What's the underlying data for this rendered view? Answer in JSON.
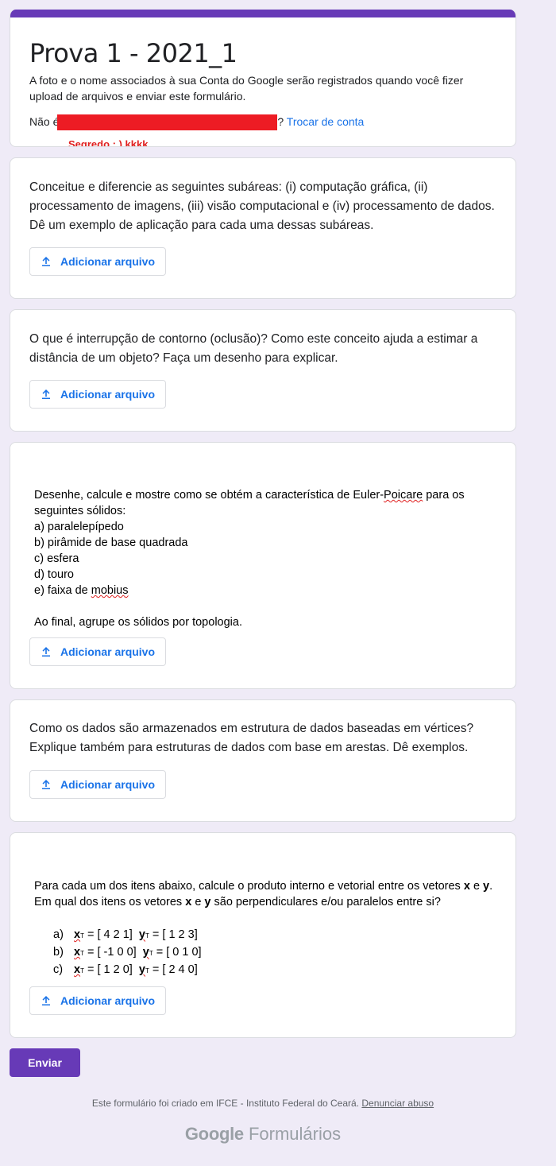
{
  "header": {
    "title": "Prova 1 - 2021_1",
    "notice": "A foto e o nome associados à sua Conta do Google serão registrados quando você fizer upload de arquivos e enviar este formulário.",
    "not_you_prefix": "Não é",
    "not_you_suffix": "?",
    "switch_account": "Trocar de conta",
    "annotation": "Segredo ; ) kkkk",
    "accent_color": "#673ab7",
    "redaction_color": "#ed1c24"
  },
  "questions": [
    {
      "text": "Conceitue e diferencie as seguintes subáreas: (i) computação gráfica, (ii) processamento de imagens, (iii) visão computacional e (iv) processamento de dados. Dê um exemplo de aplicação para cada uma dessas subáreas.",
      "upload_label": "Adicionar arquivo"
    },
    {
      "text": "O que é interrupção de contorno (oclusão)? Como este conceito ajuda a estimar a distância de um objeto? Faça um desenho para explicar.",
      "upload_label": "Adicionar arquivo"
    },
    {
      "image_text": {
        "intro_a": "Desenhe, calcule e mostre como se obtém a característica de Euler-",
        "intro_b": "Poicare",
        "intro_c": " para os seguintes sólidos:",
        "items": [
          "a) paralelepípedo",
          "b) pirâmide de base quadrada",
          "c) esfera",
          "d) touro"
        ],
        "item_e_prefix": "e) faixa de ",
        "item_e_word": "mobius",
        "closing": "Ao final, agrupe os sólidos por topologia."
      },
      "upload_label": "Adicionar arquivo"
    },
    {
      "text": "Como os dados são armazenados em estrutura de dados baseadas em vértices? Explique também para estruturas de dados com base em arestas. Dê exemplos.",
      "upload_label": "Adicionar arquivo"
    },
    {
      "image_text": {
        "intro_1": "Para cada um dos itens abaixo, calcule o produto interno e vetorial entre os vetores ",
        "x": "x",
        "intro_2": " e ",
        "y": "y",
        "intro_3": ". Em qual dos itens os vetores ",
        "intro_4": " e ",
        "intro_5": " são perpendiculares e/ou paralelos entre si?",
        "rows": [
          {
            "label": "a)",
            "xv": "= [ 4 2 1]",
            "yv": "= [ 1 2  3]"
          },
          {
            "label": "b)",
            "xv": "= [ -1 0 0]",
            "yv": "= [ 0 1 0]"
          },
          {
            "label": "c)",
            "xv": "= [ 1 2 0]",
            "yv": "= [ 2 4 0]"
          }
        ],
        "sup": "T"
      },
      "upload_label": "Adicionar arquivo"
    }
  ],
  "submit_label": "Enviar",
  "footer": {
    "text": "Este formulário foi criado em IFCE - Instituto Federal do Ceará.",
    "report_link": "Denunciar abuso"
  },
  "brand": {
    "google": "Google",
    "forms": "Formulários"
  }
}
